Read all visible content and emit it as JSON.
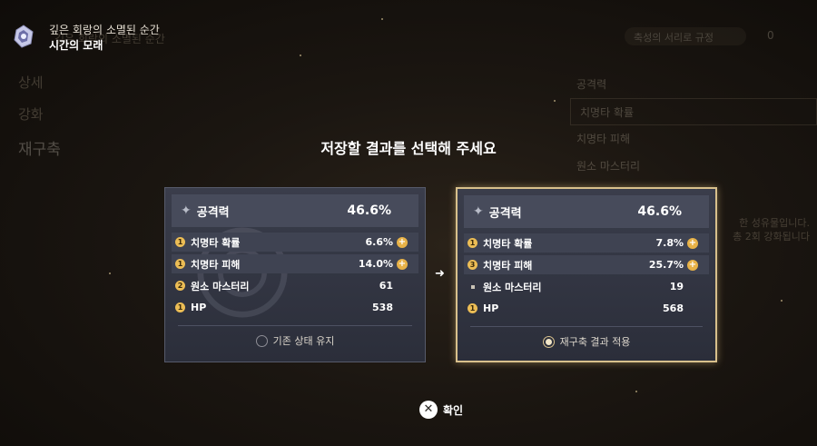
{
  "header": {
    "item_name": "깊은 회랑의 소멸된 순간",
    "item_type": "시간의 모래",
    "icon": "sands-of-eon-artifact-icon"
  },
  "background": {
    "breadcrumb": "깊은 회랑의 소멸된 순간",
    "nav": [
      "상세",
      "강화",
      "재구축"
    ],
    "pill_label": "축성의 서리로 규정",
    "pill_count": "0",
    "panel_title": "공격력",
    "panel_rows": [
      "치명타 확률",
      "치명타 피해",
      "원소 마스터리"
    ],
    "side_text": [
      "한 성유물입니다.",
      "총 2회 강화됩니다"
    ]
  },
  "dialog": {
    "title": "저장할 결과를 선택해 주세요",
    "confirm_label": "확인",
    "confirm_icon": "close-x-icon",
    "arrow_icon": "arrow-right-icon"
  },
  "cards": [
    {
      "main_stat": {
        "name": "공격력",
        "value": "46.6%"
      },
      "substats": [
        {
          "badge": "1",
          "name": "치명타 확률",
          "value": "6.6%",
          "plus": true
        },
        {
          "badge": "1",
          "name": "치명타 피해",
          "value": "14.0%",
          "plus": true
        },
        {
          "badge": "2",
          "name": "원소 마스터리",
          "value": "61",
          "plus": false
        },
        {
          "badge": "1",
          "name": "HP",
          "value": "538",
          "plus": false
        }
      ],
      "option_label": "기존 상태 유지",
      "selected": false
    },
    {
      "main_stat": {
        "name": "공격력",
        "value": "46.6%"
      },
      "substats": [
        {
          "badge": "1",
          "name": "치명타 확률",
          "value": "7.8%",
          "plus": true
        },
        {
          "badge": "3",
          "name": "치명타 피해",
          "value": "25.7%",
          "plus": true
        },
        {
          "badge": "",
          "name": "원소 마스터리",
          "value": "19",
          "plus": false
        },
        {
          "badge": "1",
          "name": "HP",
          "value": "568",
          "plus": false
        }
      ],
      "option_label": "재구축 결과 적용",
      "selected": true
    }
  ],
  "colors": {
    "accent_gold": "#d8c08c",
    "badge_gold": "#ecbd55",
    "card_bg": "#34374a"
  }
}
